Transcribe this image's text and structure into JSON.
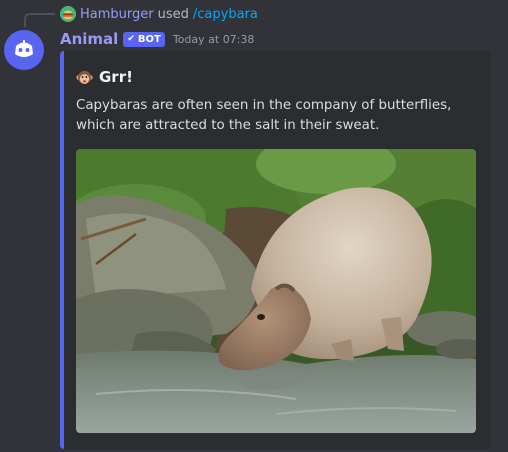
{
  "reply": {
    "user": "Hamburger",
    "used_text": "used",
    "command": "/capybara"
  },
  "message": {
    "username": "Animal",
    "bot_tag": "BOT",
    "timestamp": "Today at 07:38"
  },
  "embed": {
    "title": "Grr!",
    "title_emoji": "monkey-face-emoji",
    "description": "Capybaras are often seen in the company of butterflies, which are attracted to the salt in their sweat.",
    "accent_color": "#5865f2",
    "image_subject": "capybara-photo"
  },
  "colors": {
    "background": "#313338",
    "embed_background": "#2b2d31",
    "username": "#949cf7",
    "command": "#00a8fc",
    "bot_tag": "#5865f2"
  }
}
